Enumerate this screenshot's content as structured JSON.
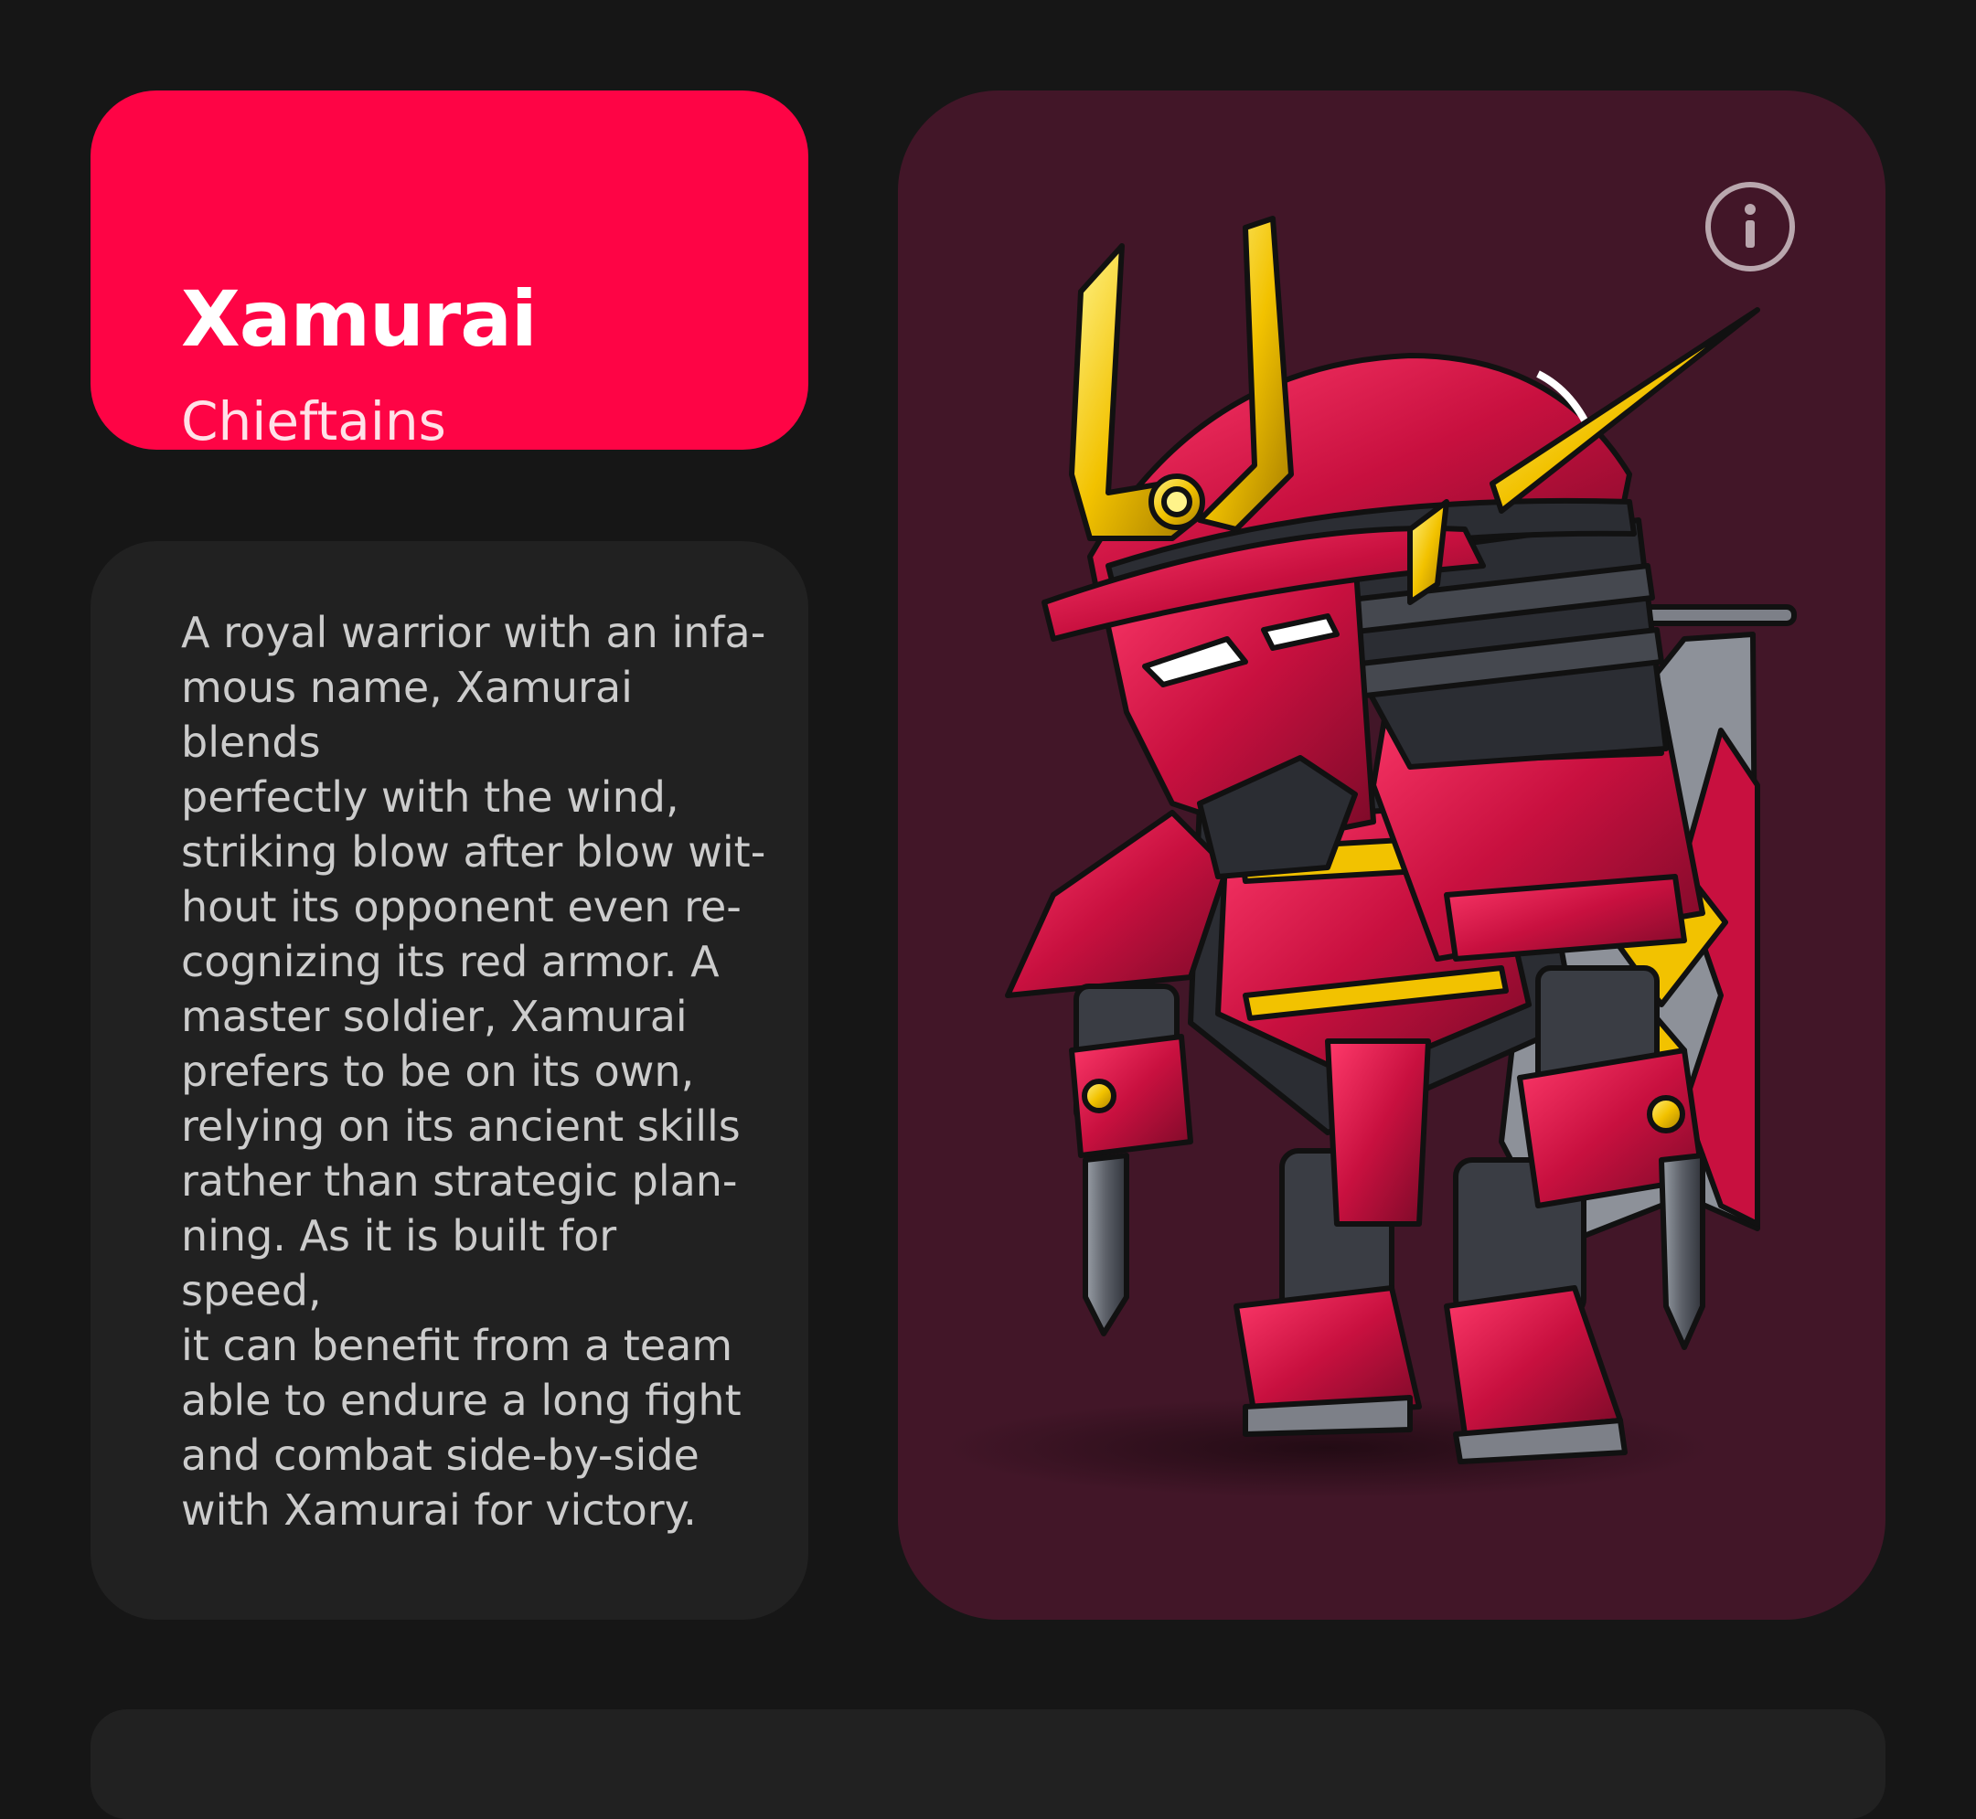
{
  "character": {
    "name": "Xamurai",
    "class": "Chieftains",
    "description": "A royal warrior with an infa-\nmous name, Xamurai blends\nperfectly with the wind,\nstriking blow after blow wit-\nhout its opponent even re-\ncognizing its red armor. A\nmaster soldier, Xamurai\nprefers to be on its own,\nrelying on its ancient skills\nrather than strategic plan-\nning. As it is built for speed,\nit can benefit from a team\nable to endure a long fight\nand combat side-by-side\nwith Xamurai for victory."
  },
  "art": {
    "info_icon": "info-icon",
    "subject": "red-samurai-robot"
  },
  "colors": {
    "accent": "#fe0445",
    "art_background": "#421628",
    "panel": "#212121",
    "page": "#161616",
    "armor_red": "#c8103f",
    "gold": "#f2c200"
  }
}
